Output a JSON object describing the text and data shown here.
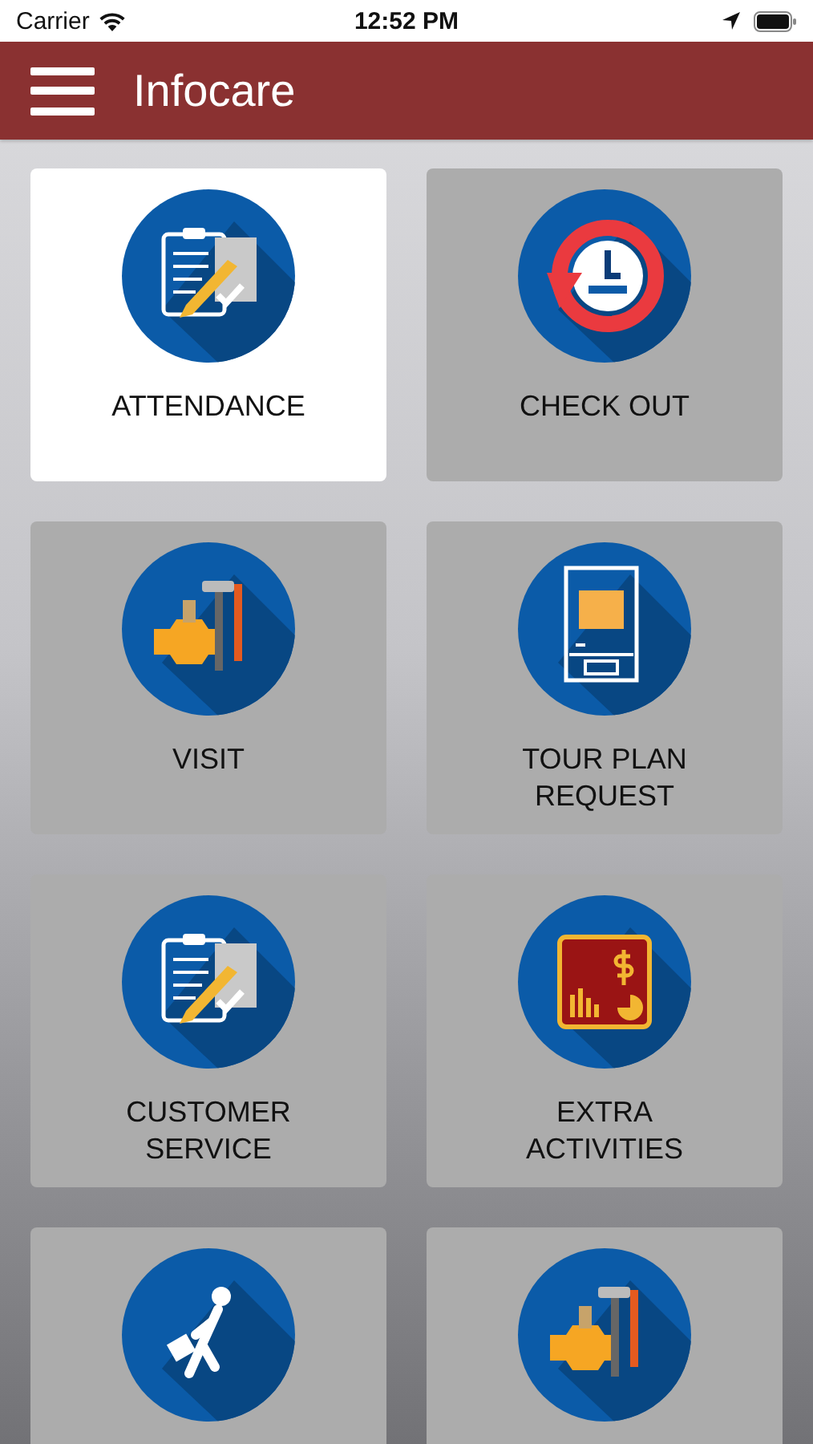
{
  "status_bar": {
    "carrier": "Carrier",
    "time": "12:52 PM"
  },
  "header": {
    "title": "Infocare"
  },
  "tiles": [
    {
      "label": "ATTENDANCE",
      "kind": "clipboard",
      "selected": true
    },
    {
      "label": "CHECK OUT",
      "kind": "clock",
      "selected": false
    },
    {
      "label": "VISIT",
      "kind": "tools",
      "selected": false
    },
    {
      "label": "TOUR PLAN REQUEST",
      "kind": "atm",
      "selected": false
    },
    {
      "label": "CUSTOMER SERVICE",
      "kind": "clipboard",
      "selected": false
    },
    {
      "label": "EXTRA ACTIVITIES",
      "kind": "chart",
      "selected": false
    },
    {
      "kind": "walker",
      "selected": false
    },
    {
      "kind": "tools",
      "selected": false
    }
  ]
}
